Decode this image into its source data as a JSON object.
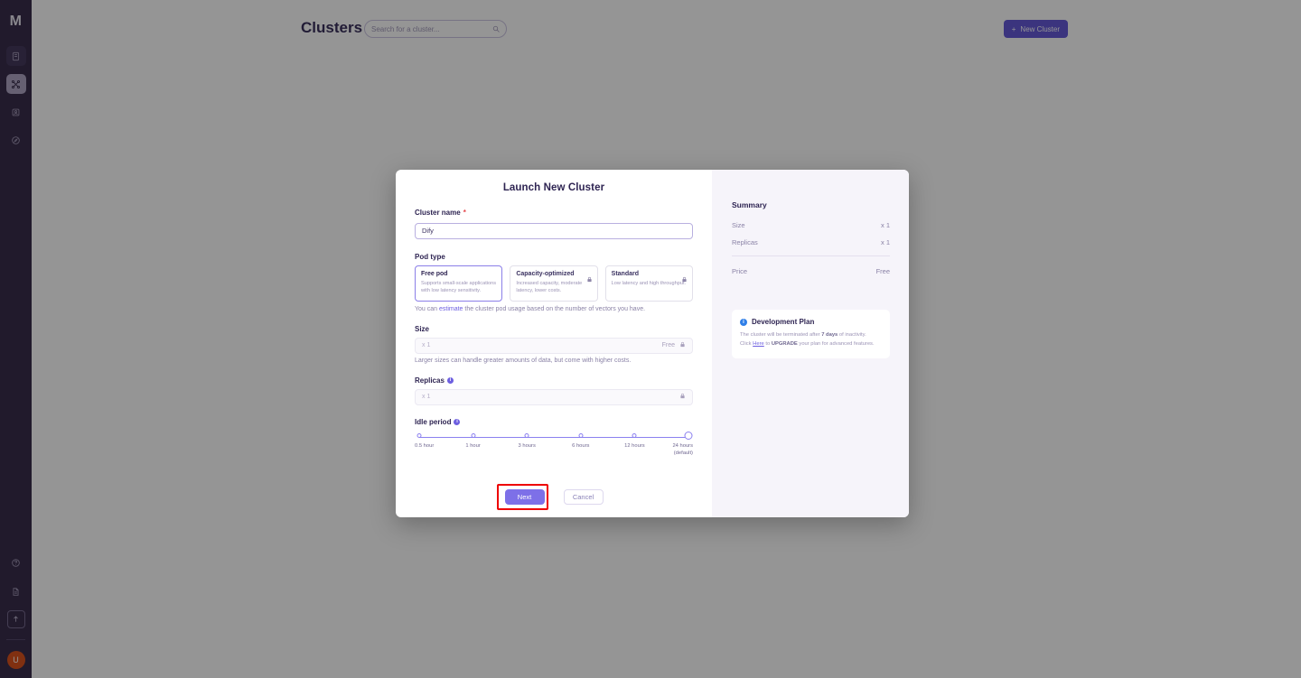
{
  "sidebar": {
    "logo": "M",
    "top_items": [
      {
        "name": "database-icon",
        "label": "Databases"
      },
      {
        "name": "clusters-icon",
        "label": "Clusters"
      },
      {
        "name": "collections-icon",
        "label": "Collections"
      },
      {
        "name": "monitoring-icon",
        "label": "Monitoring"
      }
    ],
    "bottom_items": [
      {
        "name": "help-icon",
        "label": "Help"
      },
      {
        "name": "docs-icon",
        "label": "Documentation"
      },
      {
        "name": "upgrade-icon",
        "label": "Upgrade"
      }
    ],
    "avatar_initial": "U"
  },
  "topbar": {
    "title": "Clusters",
    "search_placeholder": "Search for a cluster...",
    "search_value": "",
    "new_cluster_label": "New Cluster",
    "plus_glyph": "+"
  },
  "modal": {
    "title": "Launch New Cluster",
    "cluster_name": {
      "label": "Cluster name",
      "required_marker": "*",
      "value": "Dify",
      "placeholder": ""
    },
    "pod_type": {
      "label": "Pod type",
      "options": [
        {
          "name": "Free pod",
          "desc": "Supports small-scale applications with low latency sensitivity.",
          "locked": false,
          "selected": true
        },
        {
          "name": "Capacity-optimized",
          "desc": "Increased capacity, moderate latency, lower costs.",
          "locked": true,
          "selected": false
        },
        {
          "name": "Standard",
          "desc": "Low latency and high throughput.",
          "locked": true,
          "selected": false
        }
      ],
      "hint_pre": "You can ",
      "hint_link": "estimate",
      "hint_post": " the cluster pod usage based on the number of vectors you have."
    },
    "size": {
      "label": "Size",
      "value": "x 1",
      "badge": "Free",
      "helper": "Larger sizes can handle greater amounts of data, but come with higher costs."
    },
    "replicas": {
      "label": "Replicas",
      "value": "x 1"
    },
    "idle_period": {
      "label": "Idle period",
      "ticks": [
        {
          "label": "0.5 hour",
          "sub": ""
        },
        {
          "label": "1 hour",
          "sub": ""
        },
        {
          "label": "3 hours",
          "sub": ""
        },
        {
          "label": "6 hours",
          "sub": ""
        },
        {
          "label": "12 hours",
          "sub": ""
        },
        {
          "label": "24 hours",
          "sub": "(default)"
        }
      ],
      "selected_index": 5
    },
    "next_label": "Next",
    "cancel_label": "Cancel"
  },
  "summary": {
    "title": "Summary",
    "rows": [
      {
        "label": "Size",
        "value": "x 1"
      },
      {
        "label": "Replicas",
        "value": "x 1"
      }
    ],
    "price_label": "Price",
    "price_value": "Free"
  },
  "plan": {
    "title": "Development Plan",
    "line1_pre": "The cluster will be terminated after ",
    "line1_bold": "7 days",
    "line1_post": " of inactivity.",
    "line2_pre": "Click ",
    "line2_link": "Here",
    "line2_mid": " to ",
    "line2_bold": "UPGRADE",
    "line2_post": " your plan for advanced features."
  },
  "colors": {
    "brand_purple": "#5b4fd6",
    "sidebar_bg": "#2c2040",
    "accent_light": "#8b80ef",
    "highlight_red": "#ee0000",
    "avatar_orange": "#d9480f"
  }
}
